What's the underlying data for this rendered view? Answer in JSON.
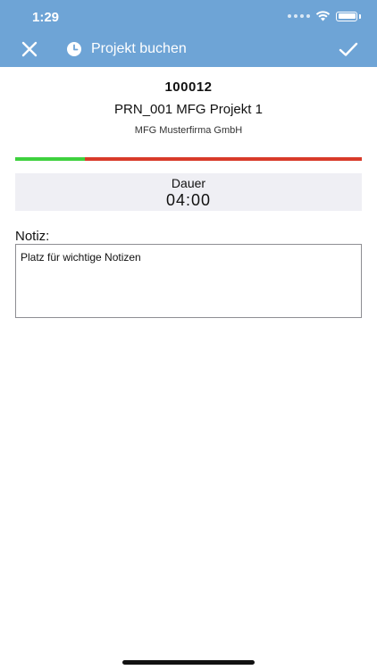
{
  "status_bar": {
    "time": "1:29"
  },
  "header": {
    "title": "Projekt buchen",
    "close_icon": "close-icon",
    "clock_icon": "clock-icon",
    "confirm_icon": "checkmark-icon",
    "background_color": "#6ea4d6"
  },
  "project": {
    "number": "100012",
    "name": "PRN_001 MFG Projekt 1",
    "company": "MFG Musterfirma GmbH"
  },
  "progress": {
    "fraction": 0.2,
    "fill_color": "#3ed13e",
    "remaining_color": "#d83b2a"
  },
  "duration": {
    "label": "Dauer",
    "value": "04:00"
  },
  "note": {
    "label": "Notiz:",
    "placeholder": "Platz für wichtige Notizen",
    "value": ""
  }
}
